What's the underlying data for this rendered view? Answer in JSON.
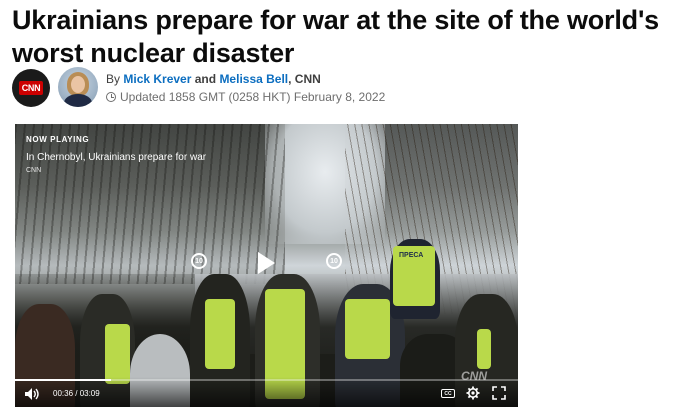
{
  "article": {
    "headline": "Ukrainians prepare for war at the site of the world's worst nuclear disaster"
  },
  "byline": {
    "logo_text": "CNN",
    "by": "By",
    "author_1": "Mick Krever",
    "and": "and",
    "author_2": "Melissa Bell",
    "source": ", CNN",
    "updated": "Updated 1858 GMT (0258 HKT) February 8, 2022"
  },
  "video": {
    "now_playing": "NOW PLAYING",
    "title": "In Chernobyl, Ukrainians prepare for war",
    "source": "CNN",
    "skip_back_label": "10",
    "skip_forward_label": "10",
    "vest_text": "ПРЕСА",
    "watermark": "CNN",
    "current_time": "00:36",
    "duration": "03:09",
    "time_display": "00:36 / 03:09",
    "progress_fraction": 0.19,
    "cc_label": "CC"
  },
  "colors": {
    "author_link": "#0c6ec0",
    "cnn_red": "#cc0000",
    "vest_yellow": "#b9d94a"
  }
}
